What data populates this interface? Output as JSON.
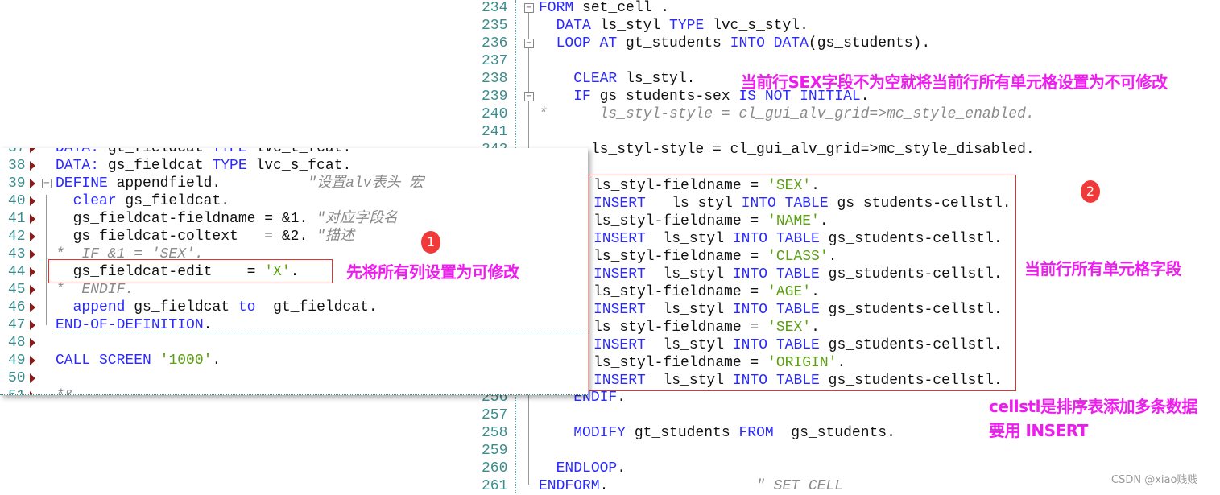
{
  "right_editor": {
    "lines": [
      {
        "n": "234",
        "fold": "box",
        "code": [
          [
            "kw",
            "FORM"
          ],
          [
            "id",
            " set_cell ."
          ]
        ]
      },
      {
        "n": "235",
        "code": [
          [
            "id",
            "  "
          ],
          [
            "kw",
            "DATA"
          ],
          [
            "id",
            " ls_styl "
          ],
          [
            "kw",
            "TYPE"
          ],
          [
            "id",
            " lvc_s_styl."
          ]
        ]
      },
      {
        "n": "236",
        "fold": "box",
        "code": [
          [
            "id",
            "  "
          ],
          [
            "kw",
            "LOOP AT"
          ],
          [
            "id",
            " gt_students "
          ],
          [
            "kw",
            "INTO DATA"
          ],
          [
            "id",
            "(gs_students)."
          ]
        ]
      },
      {
        "n": "237",
        "code": []
      },
      {
        "n": "238",
        "code": [
          [
            "id",
            "    "
          ],
          [
            "kw",
            "CLEAR"
          ],
          [
            "id",
            " ls_styl."
          ]
        ]
      },
      {
        "n": "239",
        "fold": "box",
        "code": [
          [
            "id",
            "    "
          ],
          [
            "kw",
            "IF"
          ],
          [
            "id",
            " gs_students-sex "
          ],
          [
            "kw",
            "IS NOT INITIAL"
          ],
          [
            "id",
            "."
          ]
        ]
      },
      {
        "n": "240",
        "code": [
          [
            "cm",
            "*      ls_styl-style = cl_gui_alv_grid=>mc_style_enabled."
          ]
        ]
      },
      {
        "n": "241",
        "code": []
      },
      {
        "n": "242",
        "code": [
          [
            "id",
            "      ls_styl-style = cl_gui_alv_grid=>mc_style_disabled."
          ]
        ]
      },
      {
        "n": "256",
        "code": [
          [
            "id",
            "    "
          ],
          [
            "kw",
            "ENDIF"
          ],
          [
            "id",
            "."
          ]
        ]
      },
      {
        "n": "257",
        "code": []
      },
      {
        "n": "258",
        "code": [
          [
            "id",
            "    "
          ],
          [
            "kw",
            "MODIFY"
          ],
          [
            "id",
            " gt_students "
          ],
          [
            "kw",
            "FROM"
          ],
          [
            "id",
            "  gs_students."
          ]
        ]
      },
      {
        "n": "259",
        "code": []
      },
      {
        "n": "260",
        "code": [
          [
            "id",
            "  "
          ],
          [
            "kw",
            "ENDLOOP"
          ],
          [
            "id",
            "."
          ]
        ]
      },
      {
        "n": "261",
        "code": [
          [
            "kw",
            "ENDFORM"
          ],
          [
            "id",
            ".                 "
          ],
          [
            "cm",
            "\" SET CELL"
          ]
        ]
      }
    ]
  },
  "overlay": {
    "lines": [
      [
        [
          "id",
          "ls_styl-fieldname = "
        ],
        [
          "str",
          "'SEX'"
        ],
        [
          "id",
          "."
        ]
      ],
      [
        [
          "kw",
          "INSERT"
        ],
        [
          "id",
          "   ls_styl "
        ],
        [
          "kw",
          "INTO TABLE"
        ],
        [
          "id",
          " gs_students-cellstl."
        ]
      ],
      [
        [
          "id",
          "ls_styl-fieldname = "
        ],
        [
          "str",
          "'NAME'"
        ],
        [
          "id",
          "."
        ]
      ],
      [
        [
          "kw",
          "INSERT"
        ],
        [
          "id",
          "  ls_styl "
        ],
        [
          "kw",
          "INTO TABLE"
        ],
        [
          "id",
          " gs_students-cellstl."
        ]
      ],
      [
        [
          "id",
          "ls_styl-fieldname = "
        ],
        [
          "str",
          "'CLASS'"
        ],
        [
          "id",
          "."
        ]
      ],
      [
        [
          "kw",
          "INSERT"
        ],
        [
          "id",
          "  ls_styl "
        ],
        [
          "kw",
          "INTO TABLE"
        ],
        [
          "id",
          " gs_students-cellstl."
        ]
      ],
      [
        [
          "id",
          "ls_styl-fieldname = "
        ],
        [
          "str",
          "'AGE'"
        ],
        [
          "id",
          "."
        ]
      ],
      [
        [
          "kw",
          "INSERT"
        ],
        [
          "id",
          "  ls_styl "
        ],
        [
          "kw",
          "INTO TABLE"
        ],
        [
          "id",
          " gs_students-cellstl."
        ]
      ],
      [
        [
          "id",
          "ls_styl-fieldname = "
        ],
        [
          "str",
          "'SEX'"
        ],
        [
          "id",
          "."
        ]
      ],
      [
        [
          "kw",
          "INSERT"
        ],
        [
          "id",
          "  ls_styl "
        ],
        [
          "kw",
          "INTO TABLE"
        ],
        [
          "id",
          " gs_students-cellstl."
        ]
      ],
      [
        [
          "id",
          "ls_styl-fieldname = "
        ],
        [
          "str",
          "'ORIGIN'"
        ],
        [
          "id",
          "."
        ]
      ],
      [
        [
          "kw",
          "INSERT"
        ],
        [
          "id",
          "  ls_styl "
        ],
        [
          "kw",
          "INTO TABLE"
        ],
        [
          "id",
          " gs_students-cellstl."
        ]
      ]
    ]
  },
  "left_editor": {
    "lines": [
      {
        "n": "37",
        "code": [
          [
            "kw",
            "DATA:"
          ],
          [
            "id",
            " gt_fieldcat "
          ],
          [
            "kw",
            "TYPE"
          ],
          [
            "id",
            " lvc_t_fcat."
          ]
        ]
      },
      {
        "n": "38",
        "code": [
          [
            "kw",
            "DATA:"
          ],
          [
            "id",
            " gs_fieldcat "
          ],
          [
            "kw",
            "TYPE"
          ],
          [
            "id",
            " lvc_s_fcat."
          ]
        ]
      },
      {
        "n": "39",
        "fold": "box",
        "code": [
          [
            "kw",
            "DEFINE"
          ],
          [
            "id",
            " appendfield.          "
          ],
          [
            "cm",
            "\"设置alv表头 宏"
          ]
        ]
      },
      {
        "n": "40",
        "code": [
          [
            "id",
            "  "
          ],
          [
            "kw",
            "clear"
          ],
          [
            "id",
            " gs_fieldcat."
          ]
        ]
      },
      {
        "n": "41",
        "code": [
          [
            "id",
            "  gs_fieldcat-fieldname = &1. "
          ],
          [
            "cm",
            "\"对应字段名"
          ]
        ]
      },
      {
        "n": "42",
        "code": [
          [
            "id",
            "  gs_fieldcat-coltext   = &2. "
          ],
          [
            "cm",
            "\"描述"
          ]
        ]
      },
      {
        "n": "43",
        "code": [
          [
            "cm",
            "*  IF &1 = 'SEX'."
          ]
        ]
      },
      {
        "n": "44",
        "code": [
          [
            "id",
            "  gs_fieldcat-edit    = "
          ],
          [
            "str",
            "'X'"
          ],
          [
            "id",
            "."
          ]
        ]
      },
      {
        "n": "45",
        "code": [
          [
            "cm",
            "*  ENDIF."
          ]
        ]
      },
      {
        "n": "46",
        "code": [
          [
            "id",
            "  "
          ],
          [
            "kw",
            "append"
          ],
          [
            "id",
            " gs_fieldcat "
          ],
          [
            "kw",
            "to"
          ],
          [
            "id",
            "  gt_fieldcat."
          ]
        ]
      },
      {
        "n": "47",
        "code": [
          [
            "kw",
            "END-OF-DEFINITION"
          ],
          [
            "id",
            "."
          ]
        ]
      },
      {
        "n": "48",
        "code": []
      },
      {
        "n": "49",
        "code": [
          [
            "kw",
            "CALL SCREEN"
          ],
          [
            "id",
            " "
          ],
          [
            "str",
            "'1000'"
          ],
          [
            "id",
            "."
          ]
        ]
      },
      {
        "n": "50",
        "code": []
      },
      {
        "n": "51",
        "code": [
          [
            "cm",
            "*&"
          ]
        ]
      }
    ]
  },
  "annotations": {
    "note1": "先将所有列设置为可修改",
    "note_sex": "当前行SEX字段不为空就将当前行所有单元格设置为不可修改",
    "note_fields": "当前行所有单元格字段",
    "note_cellstl_1": "cellstl是排序表添加多条数据",
    "note_cellstl_2": "要用 INSERT",
    "badge1": "1",
    "badge2": "2"
  },
  "watermark": "CSDN @xiao贱贱",
  "colors": {
    "keyword": "#2a2aff",
    "string": "#5aa010",
    "comment": "#8a8a8a",
    "annotation": "#ee1cee",
    "badge": "#f03a3a",
    "highlight_box": "#e83030"
  }
}
